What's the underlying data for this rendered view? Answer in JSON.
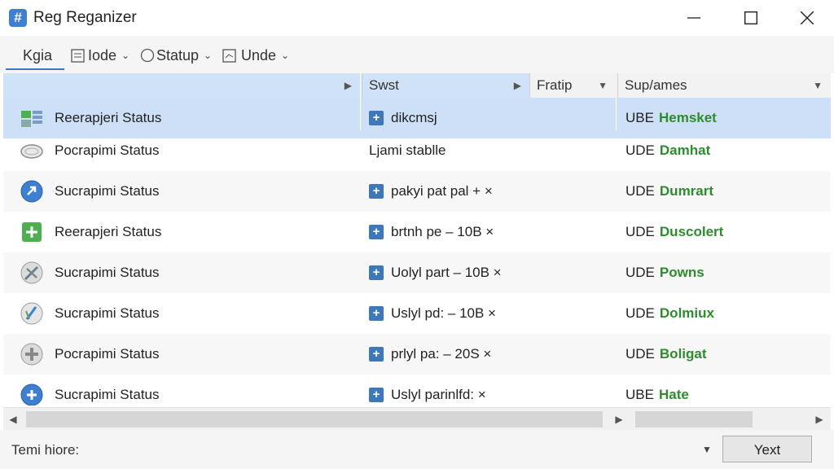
{
  "window": {
    "title": "Reg Reganizer",
    "app_icon_glyph": "#"
  },
  "toolbar": {
    "tab_label": "Kgia",
    "node_label": "Iode",
    "status_label": "Statup",
    "undo_label": "Unde"
  },
  "columns": [
    {
      "label": ""
    },
    {
      "label": "Swst"
    },
    {
      "label": "Fratip"
    },
    {
      "label": "Sup/ames"
    }
  ],
  "rows": [
    {
      "icon": "grid-icon",
      "name": "Reerapjeri Status",
      "detail": "dikcmsj",
      "detail_plus": true,
      "ube_prefix": "UBE",
      "ube_value": "Hemsket"
    },
    {
      "icon": "disk-icon",
      "name": "Pocrapimi Status",
      "detail": "Ljami stablle",
      "detail_plus": false,
      "ube_prefix": "UDE",
      "ube_value": "Damhat"
    },
    {
      "icon": "arrow-icon",
      "name": "Sucrapimi Status",
      "detail": "pakyi pat pal + ×",
      "detail_plus": true,
      "ube_prefix": "UDE",
      "ube_value": "Dumrart"
    },
    {
      "icon": "shield-plus-icon",
      "name": "Reerapjeri Status",
      "detail": "brtnh pe – 10B ×",
      "detail_plus": true,
      "ube_prefix": "UDE",
      "ube_value": "Duscolert"
    },
    {
      "icon": "tool-icon",
      "name": "Sucrapimi Status",
      "detail": "Uolyl part – 10B ×",
      "detail_plus": true,
      "ube_prefix": "UDE",
      "ube_value": "Powns"
    },
    {
      "icon": "gauge-icon",
      "name": "Sucrapimi Status",
      "detail": "Uslyl pd: – 10B ×",
      "detail_plus": true,
      "ube_prefix": "UDE",
      "ube_value": "Dolmiux"
    },
    {
      "icon": "wrench-icon",
      "name": "Pocrapimi Status",
      "detail": "prlyl pa: – 20S ×",
      "detail_plus": true,
      "ube_prefix": "UDE",
      "ube_value": "Boligat"
    },
    {
      "icon": "plus-circle-icon",
      "name": "Sucrapimi Status",
      "detail": "Uslyl parinlfd: ×",
      "detail_plus": true,
      "ube_prefix": "UBE",
      "ube_value": "Hate"
    }
  ],
  "statusbar": {
    "text": "Temi hiore:",
    "next_label": "Yext"
  },
  "colors": {
    "accent": "#3b78c4",
    "selected_row": "#cde0f7",
    "status_green": "#2e8b2e"
  }
}
